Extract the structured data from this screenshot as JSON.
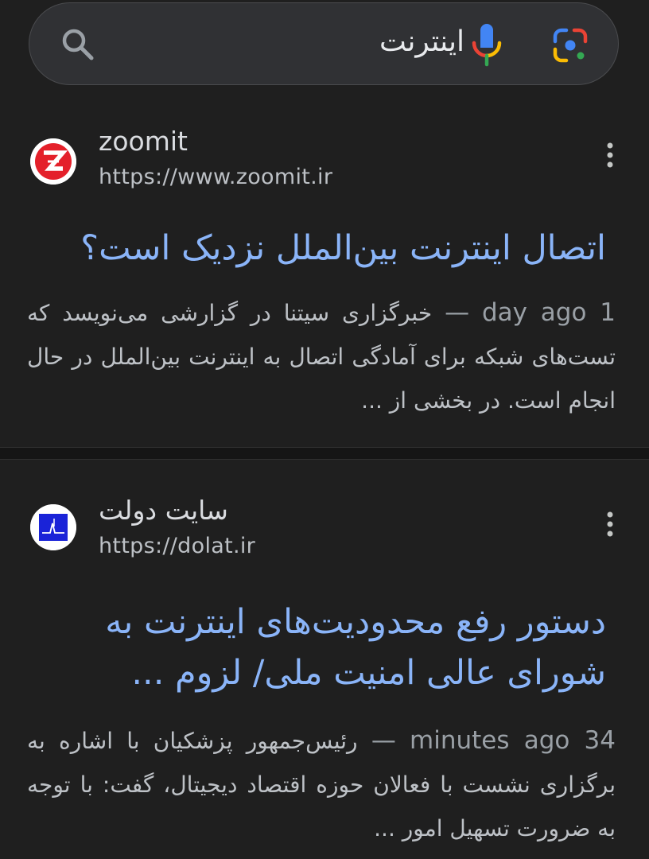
{
  "search": {
    "query": "اینترنت",
    "icons": {
      "search": "search-icon",
      "mic": "mic-icon",
      "lens": "lens-icon"
    }
  },
  "results": [
    {
      "site_name": "zoomit",
      "url": "https://www.zoomit.ir",
      "favicon": "zoomit-logo",
      "title": "اتصال اینترنت بین‌الملل نزدیک است؟",
      "date": "1 day ago",
      "separator": "—",
      "snippet": "خبرگزاری سیتنا در گزارشی می‌نویسد که تست‌های شبکه برای آمادگی اتصال به اینترنت بین‌الملل در حال انجام است. در بخشی از ..."
    },
    {
      "site_name": "سایت دولت",
      "url": "https://dolat.ir",
      "favicon": "dolat-logo",
      "title": "دستور رفع محدودیت‌های اینترنت به شورای عالی امنیت ملی/ لزوم ...",
      "date": "34 minutes ago",
      "separator": "—",
      "snippet": "رئیس‌جمهور پزشکیان با اشاره به برگزاری نشست با فعالان حوزه اقتصاد دیجیتال، گفت: با توجه به ضرورت تسهیل امور ..."
    }
  ],
  "colors": {
    "background": "#1f1f1f",
    "title_link": "#8ab4f8",
    "snippet_text": "#bdc1c6",
    "zoomit_red": "#e4202a",
    "dolat_blue": "#1a23d8"
  }
}
